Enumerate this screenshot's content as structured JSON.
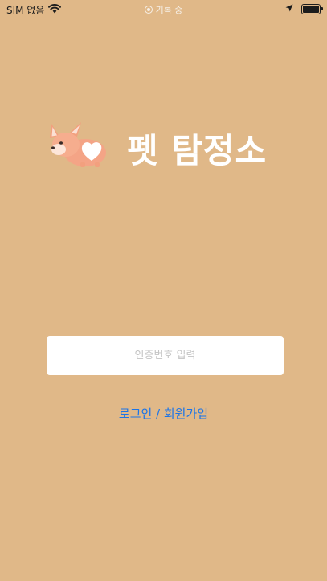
{
  "status_bar": {
    "carrier": "SIM 없음",
    "recording": "기록 중",
    "wifi_icon": "wifi-icon",
    "location_icon": "location-arrow-icon",
    "battery_icon": "battery-icon",
    "battery_level": 1.0
  },
  "app": {
    "title": "펫 탐정소",
    "logo_icon": "corgi-dog-icon"
  },
  "auth": {
    "code_placeholder": "인증번호 입력",
    "code_value": "",
    "login_label": "로그인 / 회원가입"
  },
  "colors": {
    "background": "#e0b888",
    "title": "#ffffff",
    "link": "#1a74e8",
    "input_bg": "#ffffff",
    "placeholder": "#c4c4c4"
  }
}
